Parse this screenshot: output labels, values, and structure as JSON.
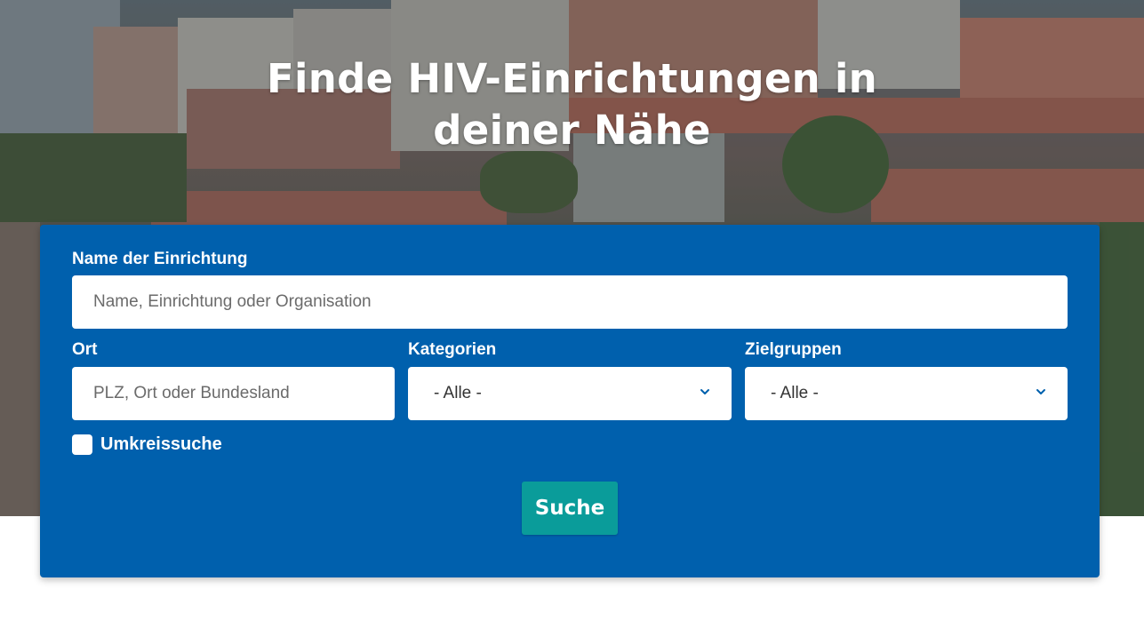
{
  "hero": {
    "title_line1": "Finde HIV-Einrichtungen in",
    "title_line2": "deiner Nähe"
  },
  "form": {
    "name": {
      "label": "Name der Einrichtung",
      "placeholder": "Name, Einrichtung oder Organisation",
      "value": ""
    },
    "ort": {
      "label": "Ort",
      "placeholder": "PLZ, Ort oder Bundesland",
      "value": ""
    },
    "kategorien": {
      "label": "Kategorien",
      "selected": "- Alle -"
    },
    "zielgruppen": {
      "label": "Zielgruppen",
      "selected": "- Alle -"
    },
    "umkreissuche": {
      "label": "Umkreissuche",
      "checked": false
    },
    "submit_label": "Suche"
  },
  "colors": {
    "card_bg": "#0060ad",
    "button_bg": "#0a9c9a",
    "chevron": "#0060ad"
  },
  "icons": {
    "select_chevron": "chevron-down-icon"
  }
}
